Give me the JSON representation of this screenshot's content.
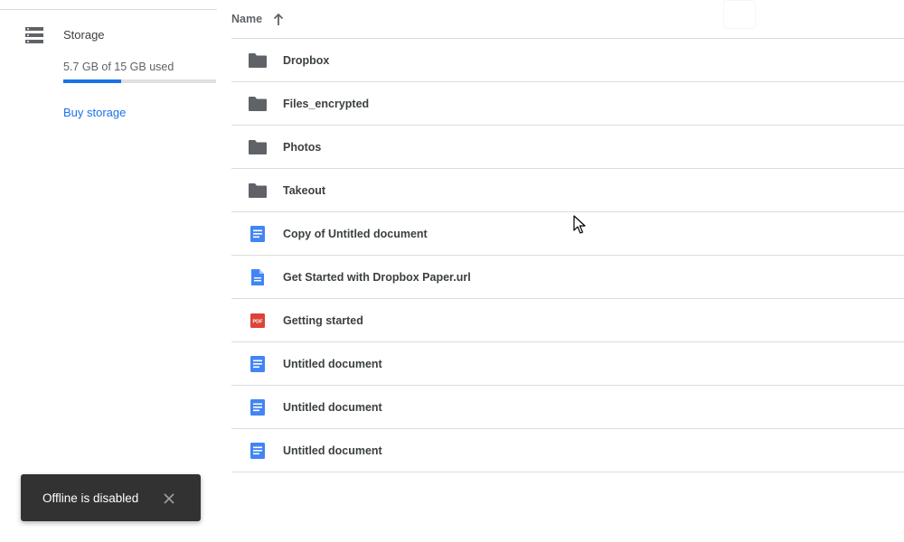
{
  "sidebar": {
    "storage_label": "Storage",
    "storage_usage": "5.7 GB of 15 GB used",
    "storage_fraction": 0.38,
    "buy_storage_label": "Buy storage",
    "storage_icon": "storage-icon"
  },
  "list": {
    "name_header": "Name",
    "sort_icon": "arrow-upward-icon",
    "files": [
      {
        "name": "Dropbox",
        "icon": "folder-icon"
      },
      {
        "name": "Files_encrypted",
        "icon": "folder-icon"
      },
      {
        "name": "Photos",
        "icon": "folder-icon"
      },
      {
        "name": "Takeout",
        "icon": "folder-icon"
      },
      {
        "name": "Copy of Untitled document",
        "icon": "google-doc-icon"
      },
      {
        "name": "Get Started with Dropbox Paper.url",
        "icon": "file-doc-icon"
      },
      {
        "name": "Getting started",
        "icon": "pdf-icon"
      },
      {
        "name": "Untitled document",
        "icon": "google-doc-icon"
      },
      {
        "name": "Untitled document",
        "icon": "google-doc-icon"
      },
      {
        "name": "Untitled document",
        "icon": "google-doc-icon"
      }
    ]
  },
  "snackbar": {
    "message": "Offline is disabled",
    "close_icon": "close-icon"
  },
  "colors": {
    "accent": "#1a73e8",
    "folder": "#5f6368",
    "doc": "#4285f4",
    "pdf": "#db4437",
    "snackbar_bg": "#323232"
  }
}
